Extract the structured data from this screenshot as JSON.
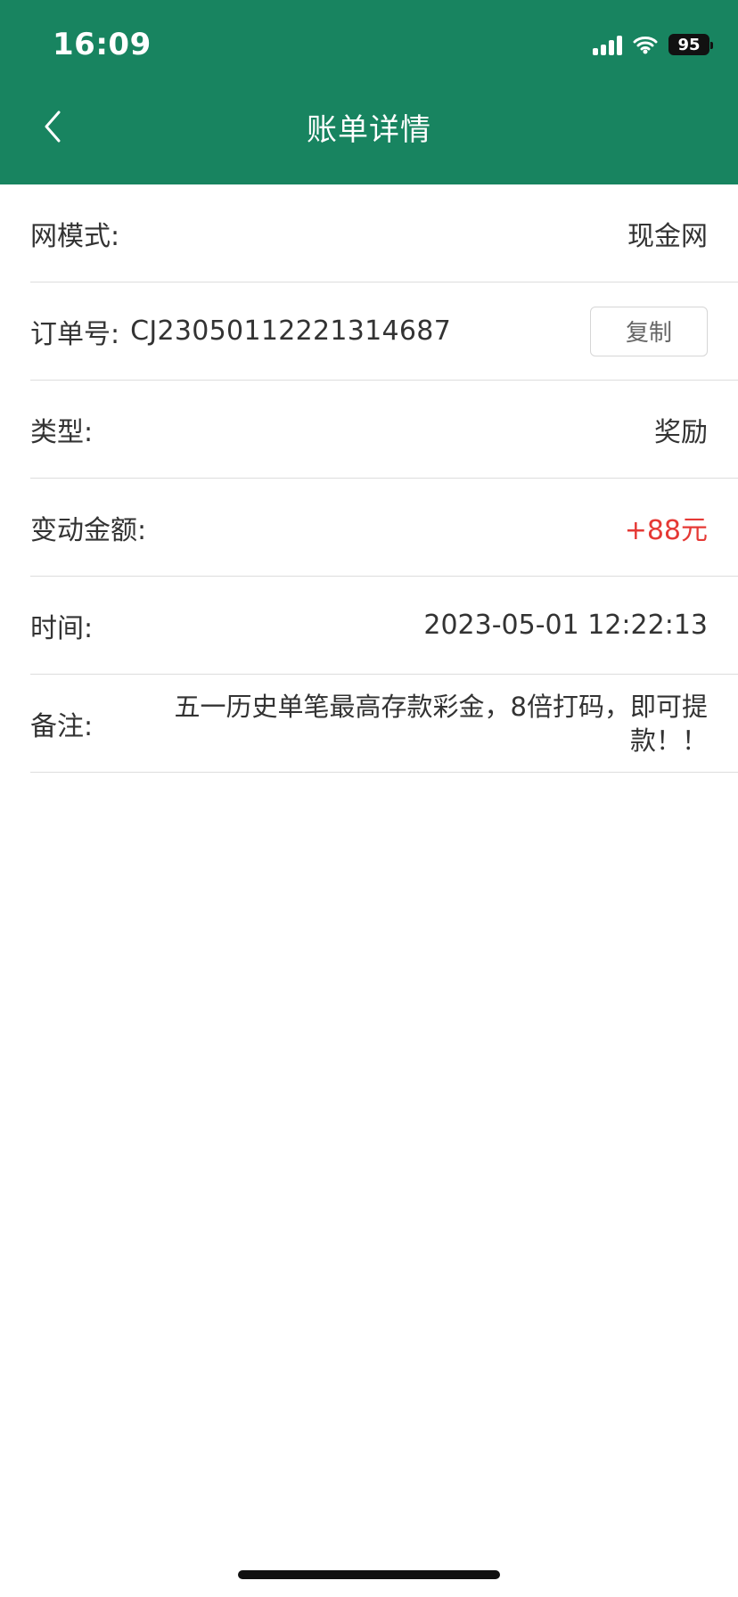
{
  "status_bar": {
    "time": "16:09",
    "battery": "95"
  },
  "header": {
    "title": "账单详情"
  },
  "details": {
    "mode": {
      "label": "网模式:",
      "value": "现金网"
    },
    "order": {
      "label": "订单号:",
      "value": "CJ23050112221314687",
      "copy_label": "复制"
    },
    "type": {
      "label": "类型:",
      "value": "奖励"
    },
    "amount": {
      "label": "变动金额:",
      "value": "+88元"
    },
    "time": {
      "label": "时间:",
      "value": "2023-05-01 12:22:13"
    },
    "note": {
      "label": "备注:",
      "value": "五一历史单笔最高存款彩金，8倍打码，即可提款！！"
    }
  },
  "colors": {
    "header_bg": "#188460",
    "amount": "#e53935"
  },
  "icons": {
    "back": "chevron-left-icon",
    "signal": "signal-icon",
    "wifi": "wifi-icon",
    "battery": "battery-icon"
  }
}
